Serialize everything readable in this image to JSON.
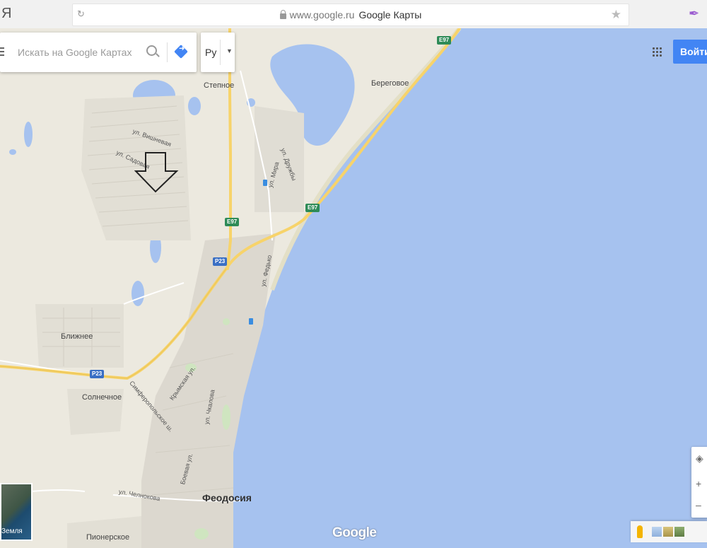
{
  "browser": {
    "logo": "Я",
    "url": "www.google.ru",
    "page_title": "Google Карты"
  },
  "search": {
    "placeholder": "Искать на Google Картах"
  },
  "language": {
    "label": "Ру"
  },
  "account": {
    "signin_label": "Войти"
  },
  "map": {
    "places": [
      {
        "name": "Степное"
      },
      {
        "name": "Береговое"
      },
      {
        "name": "Ближнее"
      },
      {
        "name": "Солнечное"
      },
      {
        "name": "Феодосия"
      },
      {
        "name": "Пионерское"
      }
    ],
    "streets": [
      {
        "name": "ул. Вишневая"
      },
      {
        "name": "ул. Садовая"
      },
      {
        "name": "ул. Мира"
      },
      {
        "name": "ул. Дружбы"
      },
      {
        "name": "ул. Федько"
      },
      {
        "name": "Симферопольское ш."
      },
      {
        "name": "Крымская ул."
      },
      {
        "name": "ул. Чкалова"
      },
      {
        "name": "ул. Челнокова"
      },
      {
        "name": "Боевая ул."
      }
    ],
    "road_shields": [
      {
        "label": "E97"
      },
      {
        "label": "E97"
      },
      {
        "label": "E97"
      },
      {
        "label": "P23"
      },
      {
        "label": "P23"
      }
    ],
    "colors": {
      "land": "#ece9df",
      "sea": "#a6c2ef",
      "road": "#f7d36a",
      "city": "#dcd8cf"
    }
  },
  "layers": {
    "earth_label": "Земля"
  },
  "branding": {
    "google_logo": "Google"
  }
}
